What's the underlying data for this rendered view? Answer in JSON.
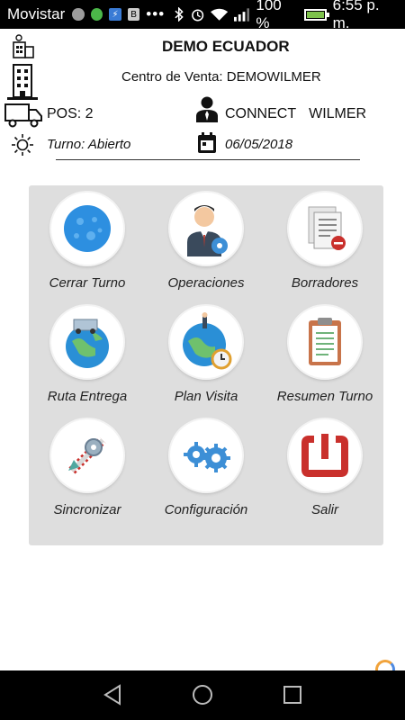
{
  "status_bar": {
    "carrier": "Movistar",
    "dots": "•••",
    "battery_text": "100 %",
    "battery_level": 1.0,
    "time": "6:55 p. m."
  },
  "header": {
    "company": "DEMO ECUADOR",
    "sales_center": "Centro de Venta: DEMOWILMER",
    "pos": "POS: 2",
    "user_first": "CONNECT",
    "user_last": "WILMER",
    "shift": "Turno: Abierto",
    "date": "06/05/2018"
  },
  "menu": [
    {
      "label": "Cerrar Turno",
      "icon": "moon-icon"
    },
    {
      "label": "Operaciones",
      "icon": "salesman-icon"
    },
    {
      "label": "Borradores",
      "icon": "drafts-icon"
    },
    {
      "label": "Ruta Entrega",
      "icon": "delivery-route-icon"
    },
    {
      "label": "Plan Visita",
      "icon": "visit-plan-icon"
    },
    {
      "label": "Resumen Turno",
      "icon": "clipboard-icon"
    },
    {
      "label": "Sincronizar",
      "icon": "sync-icon"
    },
    {
      "label": "Configuración",
      "icon": "gears-icon"
    },
    {
      "label": "Salir",
      "icon": "power-icon"
    }
  ],
  "colors": {
    "panel_bg": "#dedede",
    "status_bg": "#000000",
    "exit_red": "#c9302c",
    "globe_blue": "#2a8fd6",
    "battery_green": "#7ec24c"
  }
}
